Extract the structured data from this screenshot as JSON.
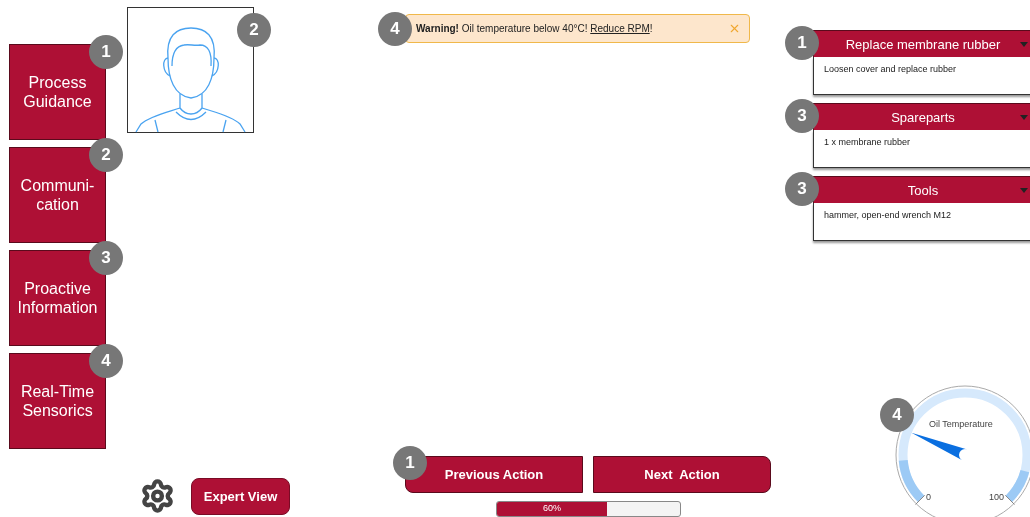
{
  "nav": [
    {
      "label": "Process\nGuidance",
      "badge": "1"
    },
    {
      "label": "Communi-\ncation",
      "badge": "2"
    },
    {
      "label": "Proactive\nInformation",
      "badge": "3"
    },
    {
      "label": "Real-Time\nSensorics",
      "badge": "4"
    }
  ],
  "profile": {
    "badge": "2"
  },
  "expert_view": {
    "label": "Expert View"
  },
  "warning": {
    "badge": "4",
    "message": "**Warning!** Oil temperature below 40°C! ",
    "link": "Reduce RPM",
    "suffix": "!"
  },
  "actions": {
    "badge": "1",
    "previous": "Previous Action",
    "next": "Next  Action"
  },
  "progress": {
    "label": "60%",
    "level": 0.6
  },
  "panels": [
    {
      "badge": "1",
      "title": "Replace membrane rubber",
      "body": "Loosen cover and replace rubber"
    },
    {
      "badge": "3",
      "title": "Spareparts",
      "body": "1 x membrane rubber"
    },
    {
      "badge": "3",
      "title": "Tools",
      "body": "hammer, open-end wrench M12"
    }
  ],
  "gauge": {
    "badge": "4",
    "title": "Oil Temperature",
    "min": "0",
    "max": "100"
  }
}
